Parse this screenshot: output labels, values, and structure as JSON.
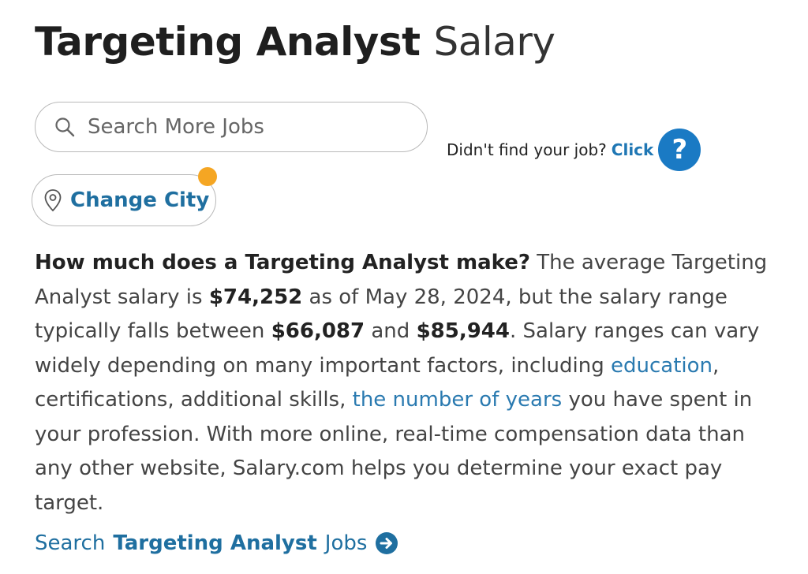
{
  "title": {
    "strong": "Targeting Analyst",
    "light": "Salary"
  },
  "search": {
    "placeholder": "Search More Jobs",
    "icon": "search-icon"
  },
  "help": {
    "text": "Didn't find your job?",
    "link": "Click",
    "icon_glyph": "?"
  },
  "city": {
    "label": "Change City",
    "icon": "location-pin-icon",
    "badge_color": "#f5a623"
  },
  "description": {
    "question": "How much does a Targeting Analyst make?",
    "p1": " The average Targeting Analyst salary is ",
    "avg": "$74,252",
    "p2": " as of May 28, 2024, but the salary range typically falls between ",
    "low": "$66,087",
    "p3": " and ",
    "high": "$85,944",
    "p4": ". Salary ranges can vary widely depending on many important factors, including ",
    "link_education": "education",
    "p5": ", certifications, additional skills, ",
    "link_years": "the number of years",
    "p6": " you have spent in your profession. With more online, real-time compensation data than any other website, Salary.com helps you determine your exact pay target."
  },
  "jobs_link": {
    "prefix": "Search",
    "role": "Targeting Analyst",
    "suffix": "Jobs",
    "icon": "arrow-circle-right-icon"
  },
  "colors": {
    "accent": "#1f6fa0",
    "help_circle": "#1a7ac4",
    "badge": "#f5a623"
  }
}
